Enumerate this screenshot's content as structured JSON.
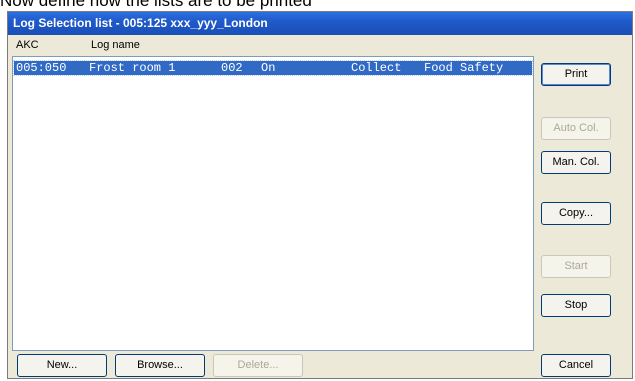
{
  "caption": "Now define how the lists are to be printed",
  "window": {
    "title": "Log Selection list - 005:125  xxx_yyy_London"
  },
  "list": {
    "columns": [
      "AKC",
      "Log name"
    ],
    "rows": [
      {
        "akc": "005:050",
        "name": "Frost room 1",
        "num": "002",
        "state": "On",
        "mode": "Collect",
        "group": "Food Safety",
        "selected": true
      }
    ]
  },
  "buttons": {
    "print": "Print",
    "auto_col": "Auto Col.",
    "man_col": "Man. Col.",
    "copy": "Copy...",
    "start": "Start",
    "stop": "Stop",
    "cancel": "Cancel",
    "new": "New...",
    "browse": "Browse...",
    "delete": "Delete..."
  }
}
